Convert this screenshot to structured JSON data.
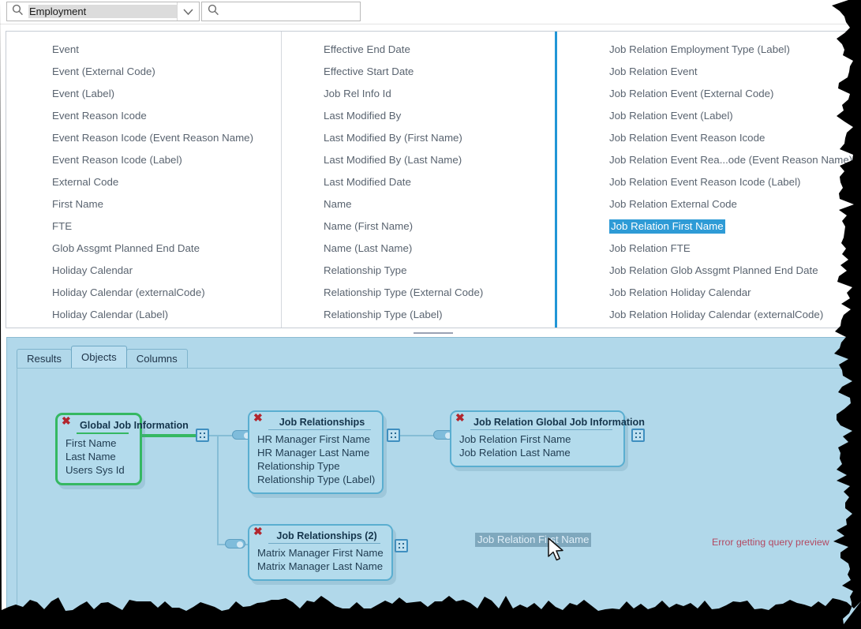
{
  "search": {
    "entity_combo_value": "Employment",
    "entity_combo_icon": "search-icon",
    "entity_combo_chevron": "chevron-down-icon",
    "filter_placeholder": "",
    "filter_value": "",
    "filter_icon": "search-icon"
  },
  "field_list": {
    "column1": [
      "Event",
      "Event (External Code)",
      "Event (Label)",
      "Event Reason Icode",
      "Event Reason Icode (Event Reason Name)",
      "Event Reason Icode (Label)",
      "External Code",
      "First Name",
      "FTE",
      "Glob Assgmt Planned End Date",
      "Holiday Calendar",
      "Holiday Calendar (externalCode)",
      "Holiday Calendar (Label)"
    ],
    "column2": [
      "Effective End Date",
      "Effective Start Date",
      "Job Rel Info Id",
      "Last Modified By",
      "Last Modified By (First Name)",
      "Last Modified By (Last Name)",
      "Last Modified Date",
      "Name",
      "Name (First Name)",
      "Name (Last Name)",
      "Relationship Type",
      "Relationship Type (External Code)",
      "Relationship Type (Label)"
    ],
    "column3": [
      "Job Relation Employment Type (Label)",
      "Job Relation Event",
      "Job Relation Event (External Code)",
      "Job Relation Event (Label)",
      "Job Relation Event Reason Icode",
      "Job Relation Event Rea...ode (Event Reason Name)",
      "Job Relation Event Reason Icode (Label)",
      "Job Relation External Code",
      "Job Relation First Name",
      "Job Relation FTE",
      "Job Relation Glob Assgmt Planned End Date",
      "Job Relation Holiday Calendar",
      "Job Relation Holiday Calendar (externalCode)"
    ],
    "selected_item": "Job Relation First Name",
    "selected_column_index": 2,
    "selected_row_index": 8,
    "selection_color": "#2e9bd6"
  },
  "tabs": [
    {
      "label": "Results",
      "active": false
    },
    {
      "label": "Objects",
      "active": true
    },
    {
      "label": "Columns",
      "active": false
    }
  ],
  "diagram": {
    "background_color": "#b1d8ea",
    "nodes": [
      {
        "title": "Global Job Information",
        "fields": [
          "First Name",
          "Last Name",
          "Users Sys Id"
        ],
        "selected": true,
        "border_color": "#35b862",
        "close_icon": "close-x-icon"
      },
      {
        "title": "Job Relationships",
        "fields": [
          "HR Manager First Name",
          "HR Manager Last Name",
          "Relationship Type",
          "Relationship Type (Label)"
        ],
        "selected": false,
        "border_color": "#5aaed0",
        "close_icon": "close-x-icon"
      },
      {
        "title": "Job Relation Global Job Information",
        "fields": [
          "Job Relation First Name",
          "Job Relation Last Name"
        ],
        "selected": false,
        "border_color": "#5aaed0",
        "close_icon": "close-x-icon"
      },
      {
        "title": "Job Relationships (2)",
        "fields": [
          "Matrix Manager First Name",
          "Matrix Manager Last Name"
        ],
        "selected": false,
        "border_color": "#5aaed0",
        "close_icon": "close-x-icon"
      }
    ],
    "drag_label": "Job Relation First Name",
    "cursor_icon": "mouse-pointer-icon",
    "error_message": "Error getting query preview",
    "error_color": "#b34a63"
  }
}
